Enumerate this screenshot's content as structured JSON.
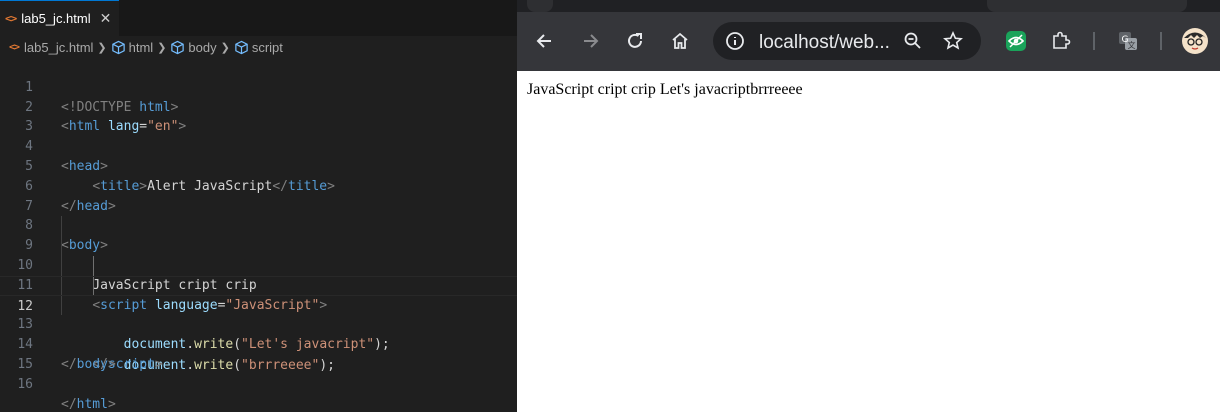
{
  "editor": {
    "tab": {
      "icon": "html-file-icon",
      "label": "lab5_jc.html",
      "close": "✕"
    },
    "breadcrumb": [
      "lab5_jc.html",
      "html",
      "body",
      "script"
    ],
    "active_line": 12,
    "lines": [
      {
        "num": "1"
      },
      {
        "num": "2"
      },
      {
        "num": "3"
      },
      {
        "num": "4"
      },
      {
        "num": "5"
      },
      {
        "num": "6"
      },
      {
        "num": "7"
      },
      {
        "num": "8"
      },
      {
        "num": "9"
      },
      {
        "num": "10"
      },
      {
        "num": "11"
      },
      {
        "num": "12"
      },
      {
        "num": "13"
      },
      {
        "num": "14"
      },
      {
        "num": "15"
      },
      {
        "num": "16"
      }
    ],
    "code": {
      "l1_a": "<!DOCTYPE ",
      "l1_b": "html",
      "l1_c": ">",
      "l2_a": "<",
      "l2_b": "html",
      "l2_c": "lang",
      "l2_d": "=",
      "l2_e": "\"en\"",
      "l2_f": ">",
      "l4_a": "<",
      "l4_b": "head",
      "l4_c": ">",
      "l5_a": "<",
      "l5_b": "title",
      "l5_c": ">",
      "l5_d": "Alert JavaScript",
      "l5_e": "</",
      "l5_f": "title",
      "l5_g": ">",
      "l6_a": "</",
      "l6_b": "head",
      "l6_c": ">",
      "l8_a": "<",
      "l8_b": "body",
      "l8_c": ">",
      "l9_a": "JavaScript cript crip",
      "l10_a": "<",
      "l10_b": "script",
      "l10_c": "language",
      "l10_d": "=",
      "l10_e": "\"JavaScript\"",
      "l10_f": ">",
      "l11_a": "document",
      "l11_b": ".",
      "l11_c": "write",
      "l11_d": "(",
      "l11_e": "\"Let's javacript\"",
      "l11_f": ");",
      "l12_a": "document",
      "l12_b": ".",
      "l12_c": "write",
      "l12_d": "(",
      "l12_e": "\"brrreeee\"",
      "l12_f": ");",
      "l13_a": "</",
      "l13_b": "script",
      "l13_c": ">",
      "l14_a": "</",
      "l14_b": "body",
      "l14_c": ">",
      "l16_a": "</",
      "l16_b": "html",
      "l16_c": ">"
    }
  },
  "browser": {
    "url": "localhost/web...",
    "page_text": "JavaScript cript crip Let's javacriptbrrreeee",
    "icons": [
      "back-icon",
      "forward-icon",
      "reload-icon",
      "home-icon",
      "site-info-icon",
      "zoom-out-icon",
      "bookmark-star-icon",
      "eye-extension-icon",
      "extensions-puzzle-icon",
      "translate-icon",
      "profile-avatar-icon"
    ]
  },
  "colors": {
    "editor_bg": "#1f1f1f",
    "tag": "#569cd6",
    "attr": "#9cdcfe",
    "string": "#ce9178",
    "function": "#dcdcaa",
    "browser_toolbar": "#35363a"
  }
}
